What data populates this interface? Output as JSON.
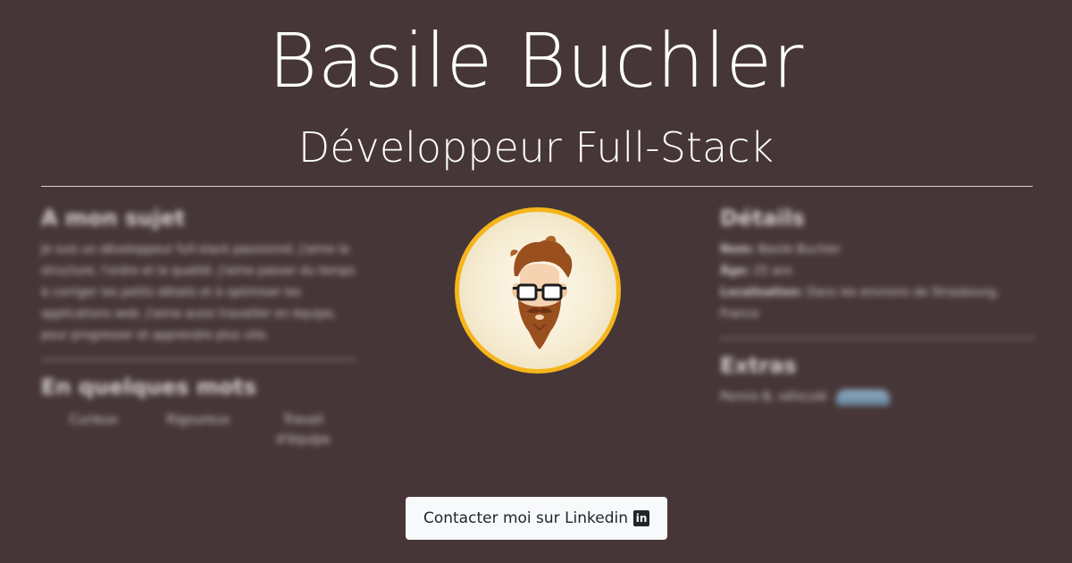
{
  "header": {
    "name": "Basile Buchler",
    "role": "Développeur Full-Stack"
  },
  "about": {
    "title": "A mon sujet",
    "text": "Je suis un développeur full-stack passionné. J'aime la structure, l'ordre et la qualité. J'aime passer du temps à corriger les petits détails et à optimiser les applications web. J'aime aussi travailler en équipe, pour progresser et apprendre plus vite."
  },
  "keywords": {
    "title": "En quelques mots",
    "items": [
      "Curieux",
      "Rigoureux",
      "Travail d'équipe"
    ]
  },
  "details": {
    "title": "Détails",
    "name_label": "Nom:",
    "name_value": "Basile Buchler",
    "age_label": "Âge:",
    "age_value": "25 ans",
    "location_label": "Localisation:",
    "location_value": "Dans les environs de Strasbourg, France"
  },
  "extras": {
    "title": "Extras",
    "text": "Permis B, véhiculé"
  },
  "avatar": {
    "icon": "bearded-hipster-avatar",
    "border_color": "#f5b51b"
  },
  "cta": {
    "label": "Contacter moi sur Linkedin",
    "icon": "linkedin-icon",
    "icon_text": "in"
  },
  "colors": {
    "background": "#463637",
    "button_bg": "#f8f9fa"
  }
}
